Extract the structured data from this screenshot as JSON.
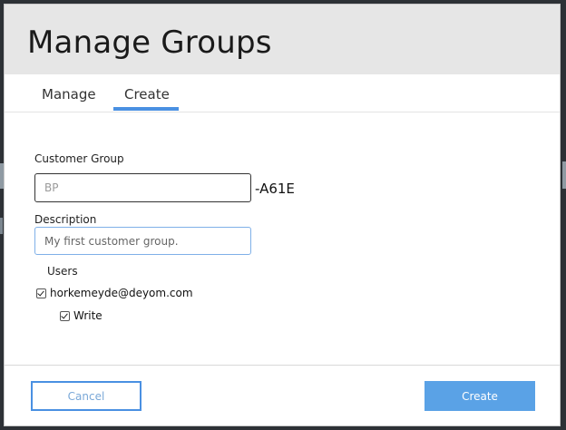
{
  "dialog": {
    "title": "Manage Groups"
  },
  "tabs": [
    {
      "label": "Manage",
      "active": false
    },
    {
      "label": "Create",
      "active": true
    }
  ],
  "form": {
    "customer_group_label": "Customer Group",
    "customer_group_placeholder": "BP",
    "customer_group_value": "",
    "customer_group_suffix": "-A61E",
    "description_label": "Description",
    "description_value": "My first customer group.",
    "users_label": "Users",
    "users": [
      {
        "email": "horkemeyde@deyom.com",
        "checked": true,
        "permissions": [
          {
            "label": "Write",
            "checked": true
          }
        ]
      }
    ]
  },
  "footer": {
    "cancel_label": "Cancel",
    "create_label": "Create"
  },
  "colors": {
    "accent": "#4a90e2",
    "primary_button": "#5aa2e6",
    "header_bg": "#e6e6e6"
  }
}
